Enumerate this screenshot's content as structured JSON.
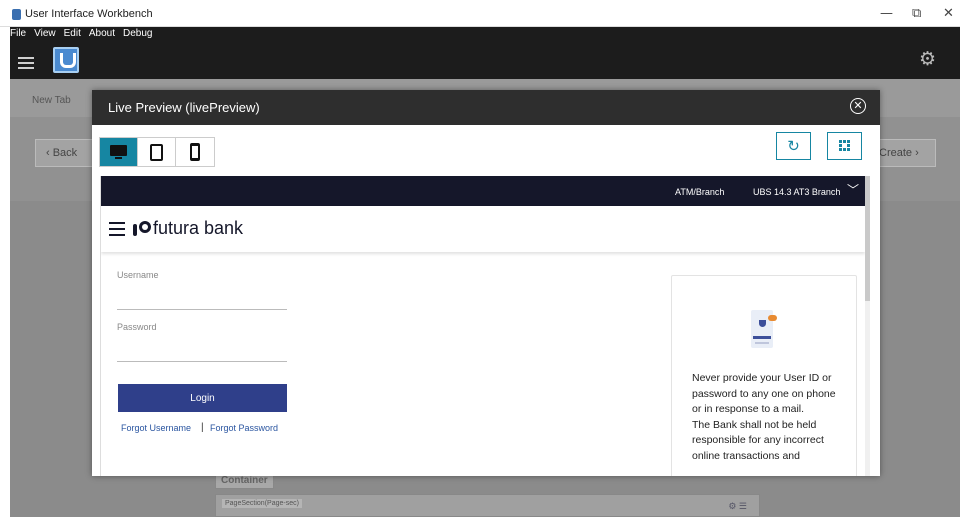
{
  "window": {
    "title": "User Interface Workbench",
    "minimize": "—",
    "restore": "⧉",
    "close": "✕"
  },
  "menu": [
    "File",
    "View",
    "Edit",
    "About",
    "Debug"
  ],
  "workbench": {
    "tab_label": "New Tab",
    "back_label": "‹  Back",
    "create_label": "Create  ›",
    "container_label": "Container",
    "page_section_tag": "PageSection(Page-sec)",
    "page_section_icons": "⚙ ☰"
  },
  "modal": {
    "title": "Live Preview (livePreview)",
    "close_glyph": "✕",
    "refresh_glyph": "↻",
    "devices": [
      "desktop",
      "tablet",
      "mobile"
    ],
    "active_device": "desktop"
  },
  "bank": {
    "atm_label": "ATM/Branch",
    "branch_label": "UBS 14.3 AT3 Branch",
    "name": "futura bank",
    "username_label": "Username",
    "password_label": "Password",
    "login_label": "Login",
    "forgot_username": "Forgot Username",
    "separator": "|",
    "forgot_password": "Forgot Password",
    "info_text": "Never provide your User ID or password to any one on phone or in response to a mail.\nThe Bank shall not be held responsible for any incorrect online transactions and"
  },
  "colors": {
    "accent": "#1686a2",
    "bank_dark": "#15172a",
    "login_button": "#2f3f8a",
    "link": "#2a55a0"
  }
}
